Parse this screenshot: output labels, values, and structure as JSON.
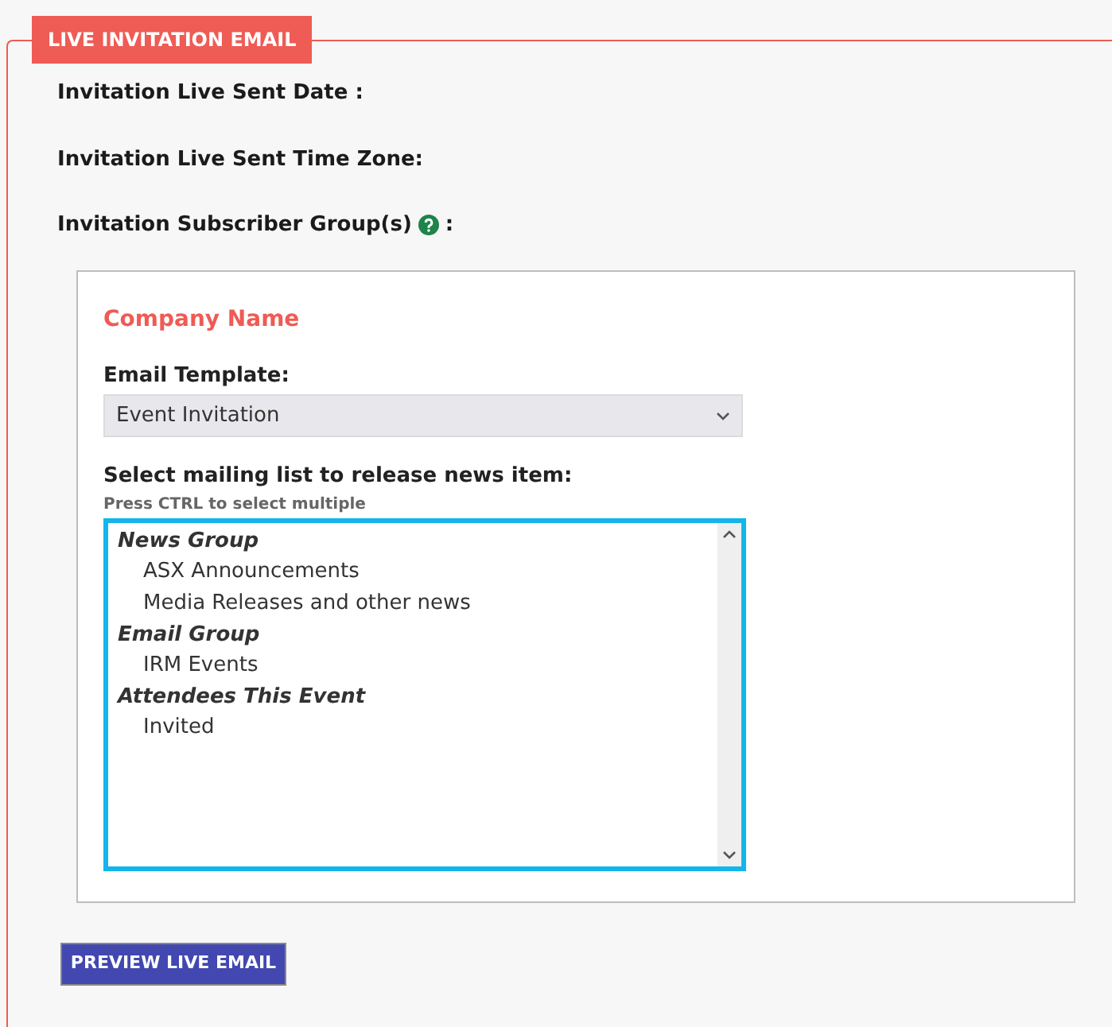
{
  "section": {
    "legend": "LIVE INVITATION EMAIL"
  },
  "fields": [
    {
      "label": "Invitation Live Sent Date :",
      "help": false
    },
    {
      "label": "Invitation Live Sent Time Zone:",
      "help": false
    },
    {
      "label": "Invitation Subscriber Group(s)",
      "help": true,
      "suffix": ":"
    }
  ],
  "company": {
    "name": "Company Name",
    "template_label": "Email Template:",
    "template_value": "Event Invitation",
    "list_label": "Select mailing list to release news item:",
    "list_hint": "Press CTRL to select multiple",
    "groups": [
      {
        "label": "News Group",
        "children": [
          {
            "label": "ASX Announcements"
          },
          {
            "label": "Media Releases and other news"
          }
        ]
      },
      {
        "label": "Email Group",
        "children": [
          {
            "label": "IRM Events"
          }
        ]
      },
      {
        "label": "Attendees This Event",
        "children": [
          {
            "label": "Invited"
          }
        ]
      }
    ]
  },
  "button": "PREVIEW LIVE EMAIL"
}
